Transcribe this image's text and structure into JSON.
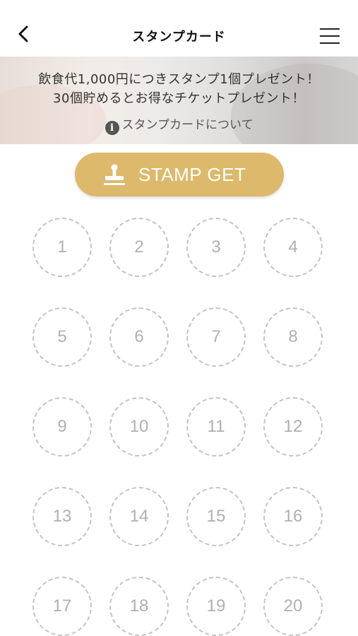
{
  "header": {
    "title": "スタンプカード",
    "back_icon": "chevron-left-icon",
    "menu_icon": "hamburger-menu-icon"
  },
  "banner": {
    "line1": "飲食代1,000円につきスタンプ1個プレゼント！",
    "line2": "30個貯めるとお得なチケットプレゼント！",
    "about_icon": "i",
    "about_label": "スタンプカードについて"
  },
  "stamp_button": {
    "label": "STAMP GET",
    "icon": "stamp-icon",
    "color": "#ddb96b"
  },
  "stamp_slots": [
    "1",
    "2",
    "3",
    "4",
    "5",
    "6",
    "7",
    "8",
    "9",
    "10",
    "11",
    "12",
    "13",
    "14",
    "15",
    "16",
    "17",
    "18",
    "19",
    "20"
  ],
  "colors": {
    "accent": "#ddb96b",
    "slot_border": "#c4c4c4",
    "slot_text": "#b0b0b0"
  }
}
